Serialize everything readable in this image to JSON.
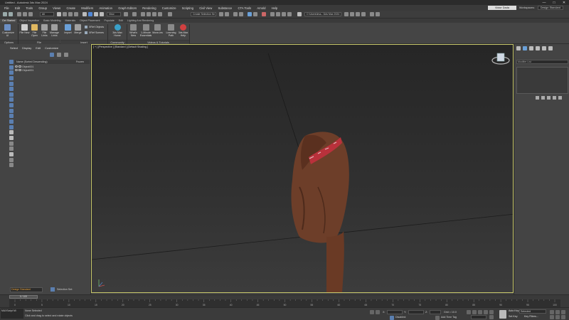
{
  "window": {
    "title": "Untitled - Autodesk 3ds Max 2024",
    "controls": [
      "—",
      "□",
      "✕"
    ]
  },
  "menubar": {
    "items": [
      "File",
      "Edit",
      "Tools",
      "Group",
      "Views",
      "Create",
      "Modifiers",
      "Animation",
      "Graph Editors",
      "Rendering",
      "Customize",
      "Scripting",
      "Civil View",
      "Substance",
      "CTA Tools",
      "Arnold",
      "Help"
    ],
    "sign_in": "Victor Dada",
    "workspace_label": "Workspaces:",
    "workspace_value": "Design Standard"
  },
  "toolbar": {
    "filter_value": "All",
    "view_value": "View",
    "selection_set_value": "Create Selection Se",
    "path_value": "C:\\Users\\Ima...\\3ds Max 2024"
  },
  "ribbon_tabs": [
    "Get Started",
    "Object Inspection",
    "Basic Modeling",
    "Materials",
    "Object Placement",
    "Populate",
    "Edit",
    "Lighting And Rendering"
  ],
  "ribbon": {
    "buttons": [
      {
        "label": "Customize UI",
        "color": "#6c8fc4"
      },
      {
        "label": "File New",
        "color": "#cfcfcf"
      },
      {
        "label": "File Open",
        "color": "#e0b860"
      },
      {
        "label": "File Links",
        "color": "#a0a0a0"
      },
      {
        "label": "Manage Links",
        "color": "#a0a0a0"
      },
      {
        "label": "Import",
        "color": "#6aa0d8"
      },
      {
        "label": "Merge",
        "color": "#a0a0a0"
      },
      {
        "label": "3ds Max Home",
        "color": "#3aa0c8"
      },
      {
        "label": "What's New",
        "color": "#8a8a8a"
      },
      {
        "label": "1-Minute Essentials",
        "color": "#8a8a8a"
      },
      {
        "label": "Move-ins",
        "color": "#8a8a8a"
      },
      {
        "label": "Learning Path",
        "color": "#8a8a8a"
      },
      {
        "label": "3ds Max Help",
        "color": "#d04040"
      }
    ],
    "xref_objects": "XRef Objects",
    "xref_scenes": "XRef Scenes",
    "groups": [
      "Options",
      "File",
      "Insert",
      "Community",
      "Videos & Tutorials"
    ]
  },
  "explorer": {
    "menu": [
      "Select",
      "Display",
      "Edit",
      "Customize"
    ],
    "column_name": "Name (Sorted Descending)",
    "column_frozen": "Frozen",
    "objects": [
      "Object001",
      "Object001"
    ],
    "layer_value": "Design Standard",
    "selection_set_label": "Selection Set:"
  },
  "viewport": {
    "label": "[ + ] [Perspective ] [Standard ] [Default Shading ]",
    "gizmo_label": "FRONT"
  },
  "command_panel": {
    "modifier_list": "Modifier List"
  },
  "timeline": {
    "slider_value": "0 / 100",
    "ticks": [
      "0",
      "5",
      "10",
      "15",
      "20",
      "25",
      "30",
      "35",
      "40",
      "45",
      "50",
      "55",
      "60",
      "65",
      "70",
      "75",
      "80",
      "85",
      "90",
      "95",
      "100"
    ]
  },
  "statusbar": {
    "maxscript": "MAXScript Mi",
    "status_primary": "None Selected",
    "status_secondary": "Click and drag to select and rotate objects",
    "x_label": "X:",
    "y_label": "Y:",
    "z_label": "Z:",
    "grid": "Grid = 10.0",
    "isolated": "Disabled:",
    "add_time_tag": "Add Time Tag",
    "auto_key": "Auto Key",
    "set_key": "Set Key",
    "selected": "Selected",
    "key_filters": "Key Filters..."
  }
}
